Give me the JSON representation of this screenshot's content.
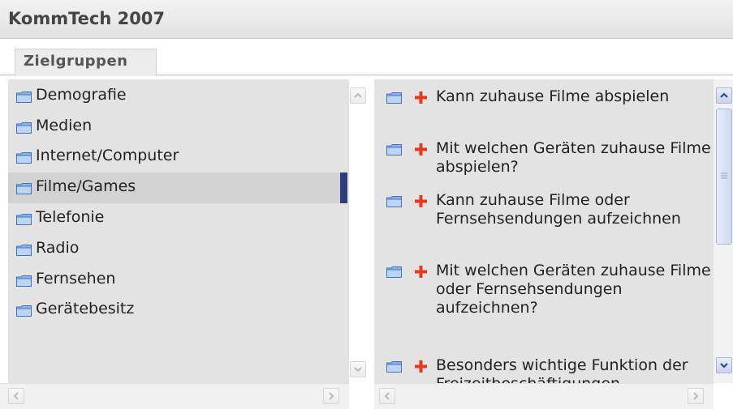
{
  "app": {
    "title": "KommTech 2007"
  },
  "tabs": [
    {
      "label": "Zielgruppen"
    }
  ],
  "categories": [
    {
      "label": "Demografie",
      "selected": false
    },
    {
      "label": "Medien",
      "selected": false
    },
    {
      "label": "Internet/Computer",
      "selected": false
    },
    {
      "label": "Filme/Games",
      "selected": true
    },
    {
      "label": "Telefonie",
      "selected": false
    },
    {
      "label": "Radio",
      "selected": false
    },
    {
      "label": "Fernsehen",
      "selected": false
    },
    {
      "label": "Gerätebesitz",
      "selected": false
    }
  ],
  "variables": [
    {
      "label": "Kann zuhause Filme abspielen"
    },
    {
      "label": "Mit welchen Geräten zuhause Filme abspielen?"
    },
    {
      "label": "Kann zuhause Filme oder Fernsehsendungen aufzeichnen"
    },
    {
      "label": "Mit welchen Geräten zuhause Filme oder Fernsehsendungen aufzeichnen?"
    },
    {
      "label": "Besonders wichtige Funktion der Freizeitbeschäftigungen"
    }
  ],
  "colors": {
    "selected_marker": "#2d3e7a",
    "plus": "#e8391c",
    "folder": "#5b8fd6"
  },
  "icons": {
    "folder": "folder-icon",
    "add": "plus-icon",
    "scroll_up": "arrow-up-icon",
    "scroll_down": "arrow-down-icon",
    "scroll_left": "arrow-left-icon",
    "scroll_right": "arrow-right-icon"
  }
}
